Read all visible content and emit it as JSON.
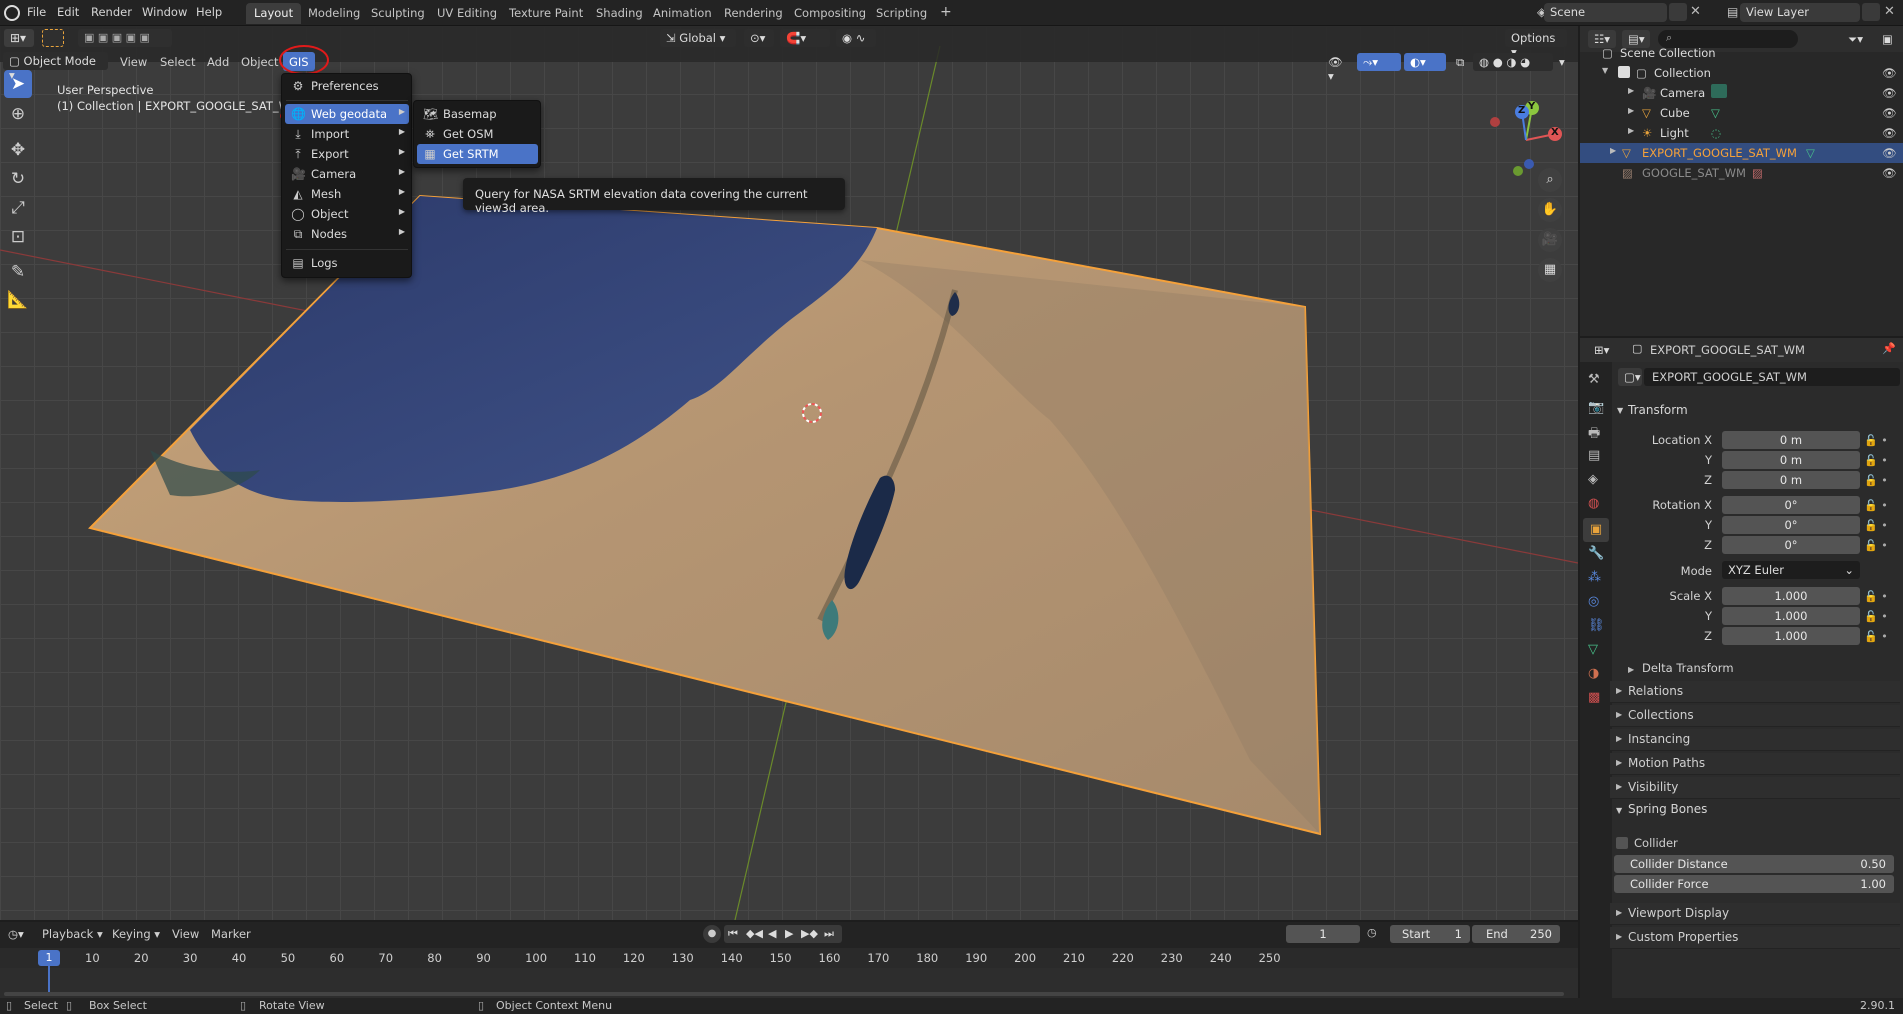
{
  "topbar": {
    "menus": [
      "File",
      "Edit",
      "Render",
      "Window",
      "Help"
    ],
    "workspaces": [
      "Layout",
      "Modeling",
      "Sculpting",
      "UV Editing",
      "Texture Paint",
      "Shading",
      "Animation",
      "Rendering",
      "Compositing",
      "Scripting"
    ],
    "active_workspace": "Layout",
    "add_tab": "+",
    "scene": "Scene",
    "view_layer": "View Layer"
  },
  "vp_header": {
    "mode": "Object Mode",
    "menus": [
      "View",
      "Select",
      "Add",
      "Object",
      "GIS"
    ],
    "orientation": "Global",
    "options": "Options"
  },
  "viewport": {
    "perspective": "User Perspective",
    "collection_info": "(1) Collection | EXPORT_GOOGLE_SAT_WM",
    "tooltip": "Query for NASA SRTM elevation data covering the current view3d area.",
    "gizmo_axes": [
      "X",
      "Y",
      "Z"
    ]
  },
  "gis_menu": {
    "items": [
      {
        "label": "Preferences",
        "icon": "gear-icon"
      },
      {
        "label": "Web geodata",
        "icon": "globe-icon",
        "submenu": true
      },
      {
        "label": "Import",
        "icon": "import-icon",
        "submenu": true
      },
      {
        "label": "Export",
        "icon": "export-icon",
        "submenu": true
      },
      {
        "label": "Camera",
        "icon": "camera-icon",
        "submenu": true
      },
      {
        "label": "Mesh",
        "icon": "mesh-icon",
        "submenu": true
      },
      {
        "label": "Object",
        "icon": "object-icon",
        "submenu": true
      },
      {
        "label": "Nodes",
        "icon": "nodes-icon",
        "submenu": true
      },
      {
        "label": "Logs",
        "icon": "logs-icon"
      }
    ]
  },
  "web_geodata_menu": {
    "items": [
      {
        "label": "Basemap",
        "icon": "basemap-icon"
      },
      {
        "label": "Get OSM",
        "icon": "osm-icon"
      },
      {
        "label": "Get SRTM",
        "icon": "srtm-icon"
      }
    ]
  },
  "outliner": {
    "search_placeholder": "",
    "rows": [
      {
        "label": "Scene Collection"
      },
      {
        "label": "Collection"
      },
      {
        "label": "Camera"
      },
      {
        "label": "Cube"
      },
      {
        "label": "Light"
      },
      {
        "label": "EXPORT_GOOGLE_SAT_WM"
      },
      {
        "label": "GOOGLE_SAT_WM"
      }
    ]
  },
  "properties": {
    "header_object": "EXPORT_GOOGLE_SAT_WM",
    "object_name": "EXPORT_GOOGLE_SAT_WM",
    "transform_title": "Transform",
    "location_label": "Location X",
    "rotation_label": "Rotation X",
    "scale_label": "Scale X",
    "y": "Y",
    "z": "Z",
    "location": [
      "0 m",
      "0 m",
      "0 m"
    ],
    "rotation": [
      "0°",
      "0°",
      "0°"
    ],
    "mode_label": "Mode",
    "mode_value": "XYZ Euler",
    "scale": [
      "1.000",
      "1.000",
      "1.000"
    ],
    "delta_transform": "Delta Transform",
    "panels": [
      "Relations",
      "Collections",
      "Instancing",
      "Motion Paths",
      "Visibility"
    ],
    "spring_bones": "Spring Bones",
    "collider": "Collider",
    "collider_distance_label": "Collider Distance",
    "collider_distance": "0.50",
    "collider_force_label": "Collider Force",
    "collider_force": "1.00",
    "viewport_display": "Viewport Display",
    "custom_properties": "Custom Properties",
    "version": "2.90.1"
  },
  "timeline": {
    "menus": [
      "Playback",
      "Keying",
      "View",
      "Marker"
    ],
    "current_frame": "1",
    "start_label": "Start",
    "start": "1",
    "end_label": "End",
    "end": "250",
    "playhead": "1",
    "ticks": [
      "10",
      "20",
      "30",
      "40",
      "50",
      "60",
      "70",
      "80",
      "90",
      "100",
      "110",
      "120",
      "130",
      "140",
      "150",
      "160",
      "170",
      "180",
      "190",
      "200",
      "210",
      "220",
      "230",
      "240",
      "250"
    ]
  },
  "status": {
    "select": "Select",
    "box_select": "Box Select",
    "rotate_view": "Rotate View",
    "context_menu": "Object Context Menu"
  },
  "colors": {
    "accent": "#4a73c7",
    "selection_orange": "#f5a13a",
    "annotation_red": "#e01a1a"
  }
}
